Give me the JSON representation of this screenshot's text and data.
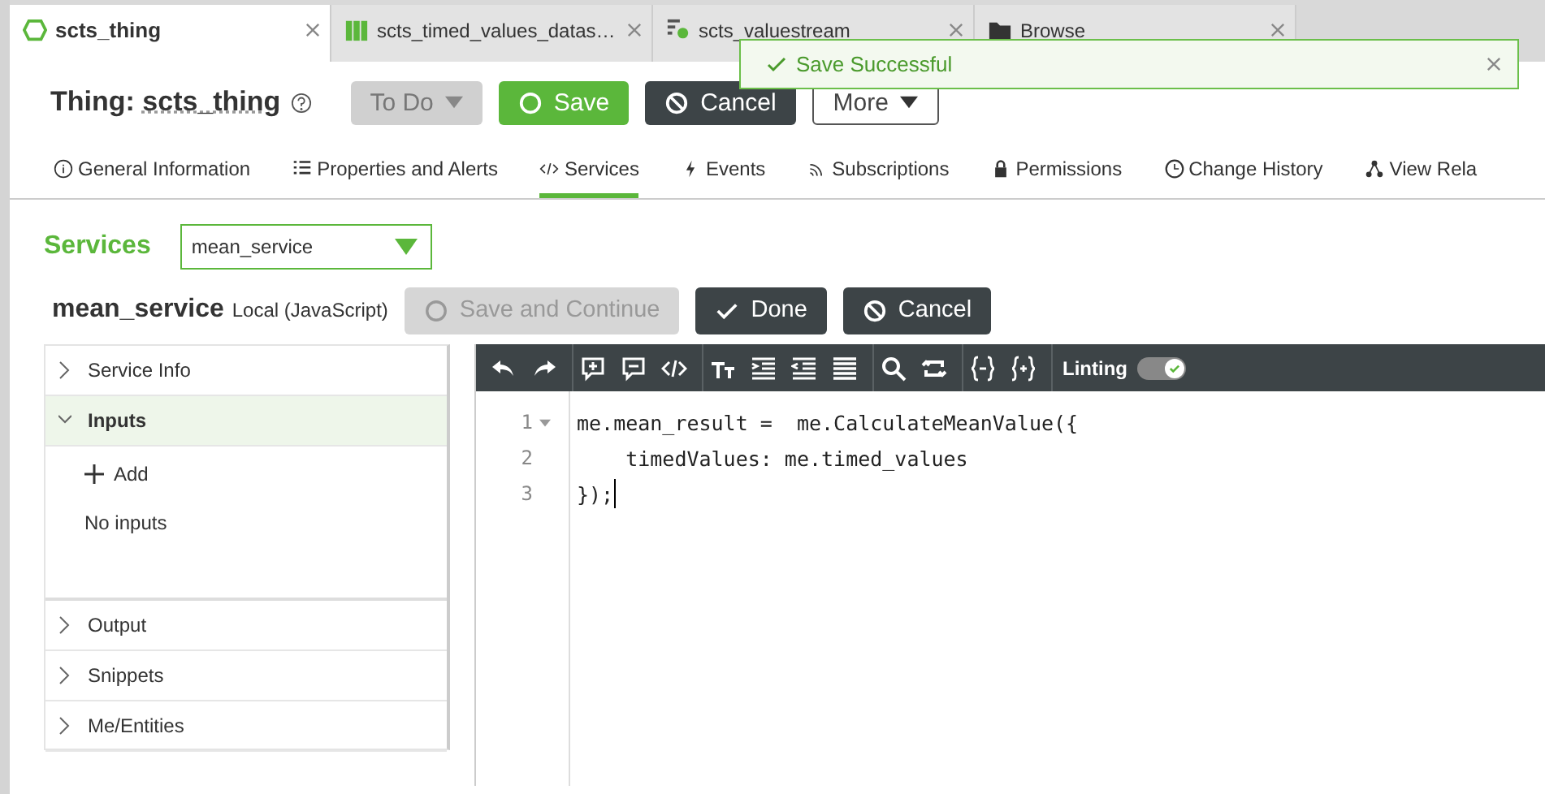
{
  "tabs": [
    {
      "label": "scts_thing",
      "selected": true
    },
    {
      "label": "scts_timed_values_datas…",
      "selected": false
    },
    {
      "label": "scts_valuestream",
      "selected": false
    },
    {
      "label": "Browse",
      "selected": false
    }
  ],
  "toast": {
    "text": "Save Successful"
  },
  "header": {
    "prefix": "Thing:",
    "name": "scts_thing",
    "buttons": [
      {
        "label": "To Do",
        "kind": "todo"
      },
      {
        "label": "Save",
        "kind": "save"
      },
      {
        "label": "Cancel",
        "kind": "cancel"
      },
      {
        "label": "More",
        "kind": "more"
      }
    ]
  },
  "nav_tabs": [
    {
      "label": "General Information",
      "selected": false
    },
    {
      "label": "Properties and Alerts",
      "selected": false
    },
    {
      "label": "Services",
      "selected": true
    },
    {
      "label": "Events",
      "selected": false
    },
    {
      "label": "Subscriptions",
      "selected": false
    },
    {
      "label": "Permissions",
      "selected": false
    },
    {
      "label": "Change History",
      "selected": false
    },
    {
      "label": "View Rela",
      "selected": false
    }
  ],
  "services": {
    "label": "Services",
    "value": "mean_service"
  },
  "service": {
    "name": "mean_service",
    "type": "Local (JavaScript)",
    "buttons": [
      {
        "label": "Save and Continue",
        "kind": "save",
        "disabled": true
      },
      {
        "label": "Done",
        "kind": "done",
        "disabled": false
      },
      {
        "label": "Cancel",
        "kind": "cancel",
        "disabled": false
      }
    ]
  },
  "sections": [
    {
      "label": "Service Info",
      "expanded": false
    },
    {
      "label": "Inputs",
      "expanded": true,
      "add_label": "Add",
      "empty_text": "No inputs"
    },
    {
      "label": "Output",
      "expanded": false
    },
    {
      "label": "Snippets",
      "expanded": false
    },
    {
      "label": "Me/Entities",
      "expanded": false
    }
  ],
  "editor": {
    "linting_label": "Linting",
    "linting_on": true,
    "lines": [
      {
        "number": "1",
        "text": "me.mean_result =  me.CalculateMeanValue({",
        "foldable": true
      },
      {
        "number": "2",
        "text": "    timedValues: me.timed_values",
        "foldable": false
      },
      {
        "number": "3",
        "text": "});",
        "foldable": false
      }
    ]
  }
}
